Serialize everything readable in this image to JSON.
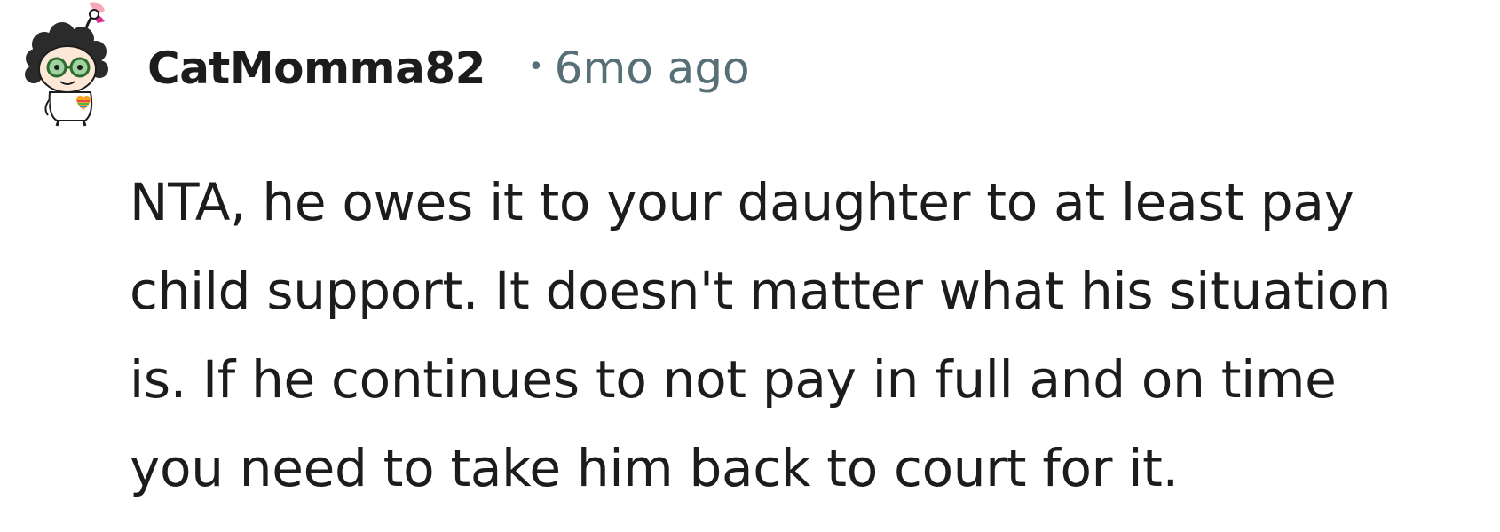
{
  "comment": {
    "username": "CatMomma82",
    "separator": "•",
    "timestamp": "6mo ago",
    "body_lines": [
      "NTA, he owes it to your daughter to at least pay",
      "child support. It doesn't matter what his situation",
      "is. If he continues to not pay in full and on time",
      "you need to take him back to court for it."
    ],
    "avatar_icon": "snoo-avatar-icon"
  }
}
